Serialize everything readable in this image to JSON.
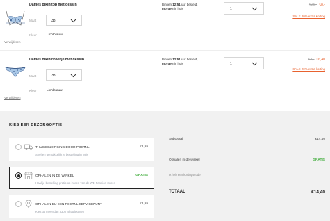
{
  "cart": {
    "items": [
      {
        "name": "Dames bikinitop met dessin",
        "maat_label": "Maat",
        "size": "38",
        "kleur_label": "Kleur",
        "color": "Lichtblauw",
        "remove": "Verwijderen",
        "delivery_prefix": "Binnen ",
        "delivery_time": "12:51",
        "delivery_mid": " uur besteld,",
        "delivery_day": "morgen",
        "delivery_suffix": " in huis",
        "quantity": "1",
        "old_price": "€25,-",
        "new_price": "€8,-",
        "sale": "SALE 20% extra korting"
      },
      {
        "name": "Dames bikinibroekje met dessin",
        "maat_label": "Maat",
        "size": "38",
        "kleur_label": "Kleur",
        "color": "Lichtblauw",
        "remove": "Verwijderen",
        "delivery_prefix": "Binnen ",
        "delivery_time": "12:51",
        "delivery_mid": " uur besteld,",
        "delivery_day": "morgen",
        "delivery_suffix": " in huis",
        "quantity": "1",
        "old_price": "€8,-",
        "new_price": "€6,40",
        "sale": "SALE 20% extra korting"
      }
    ]
  },
  "delivery": {
    "title": "KIES EEN BEZORGOPTIE",
    "options": [
      {
        "icon": "truck-icon",
        "title": "THUISBEZORGING DOOR POSTNL",
        "desc": "Snel en gemakkelijk je bestelling in huis",
        "price": "€3,99",
        "selected": false
      },
      {
        "icon": "store-icon",
        "title": "OPHALEN IN DE WINKEL",
        "desc": "Haal je bestelling gratis op in een van de WE Fashion stores",
        "price": "GRATIS",
        "selected": true
      },
      {
        "icon": "map-pin-icon",
        "title": "OPHALEN BIJ EEN POSTNL SERVICEPUNT",
        "desc": "Kies uit meer dan 3300 afhaalpunten",
        "price": "€3,99",
        "selected": false
      }
    ]
  },
  "summary": {
    "subtotal_label": "Subtotaal",
    "subtotal": "€14,40",
    "pickup_label": "Ophalen in de winkel",
    "pickup_value": "GRATIS",
    "promo_link": "Ik heb een kortingscode",
    "total_label": "TOTAAL",
    "total": "€14,40"
  },
  "colors": {
    "accent": "#e8622f",
    "free": "#3aaa35",
    "panel": "#f1f1f1"
  }
}
